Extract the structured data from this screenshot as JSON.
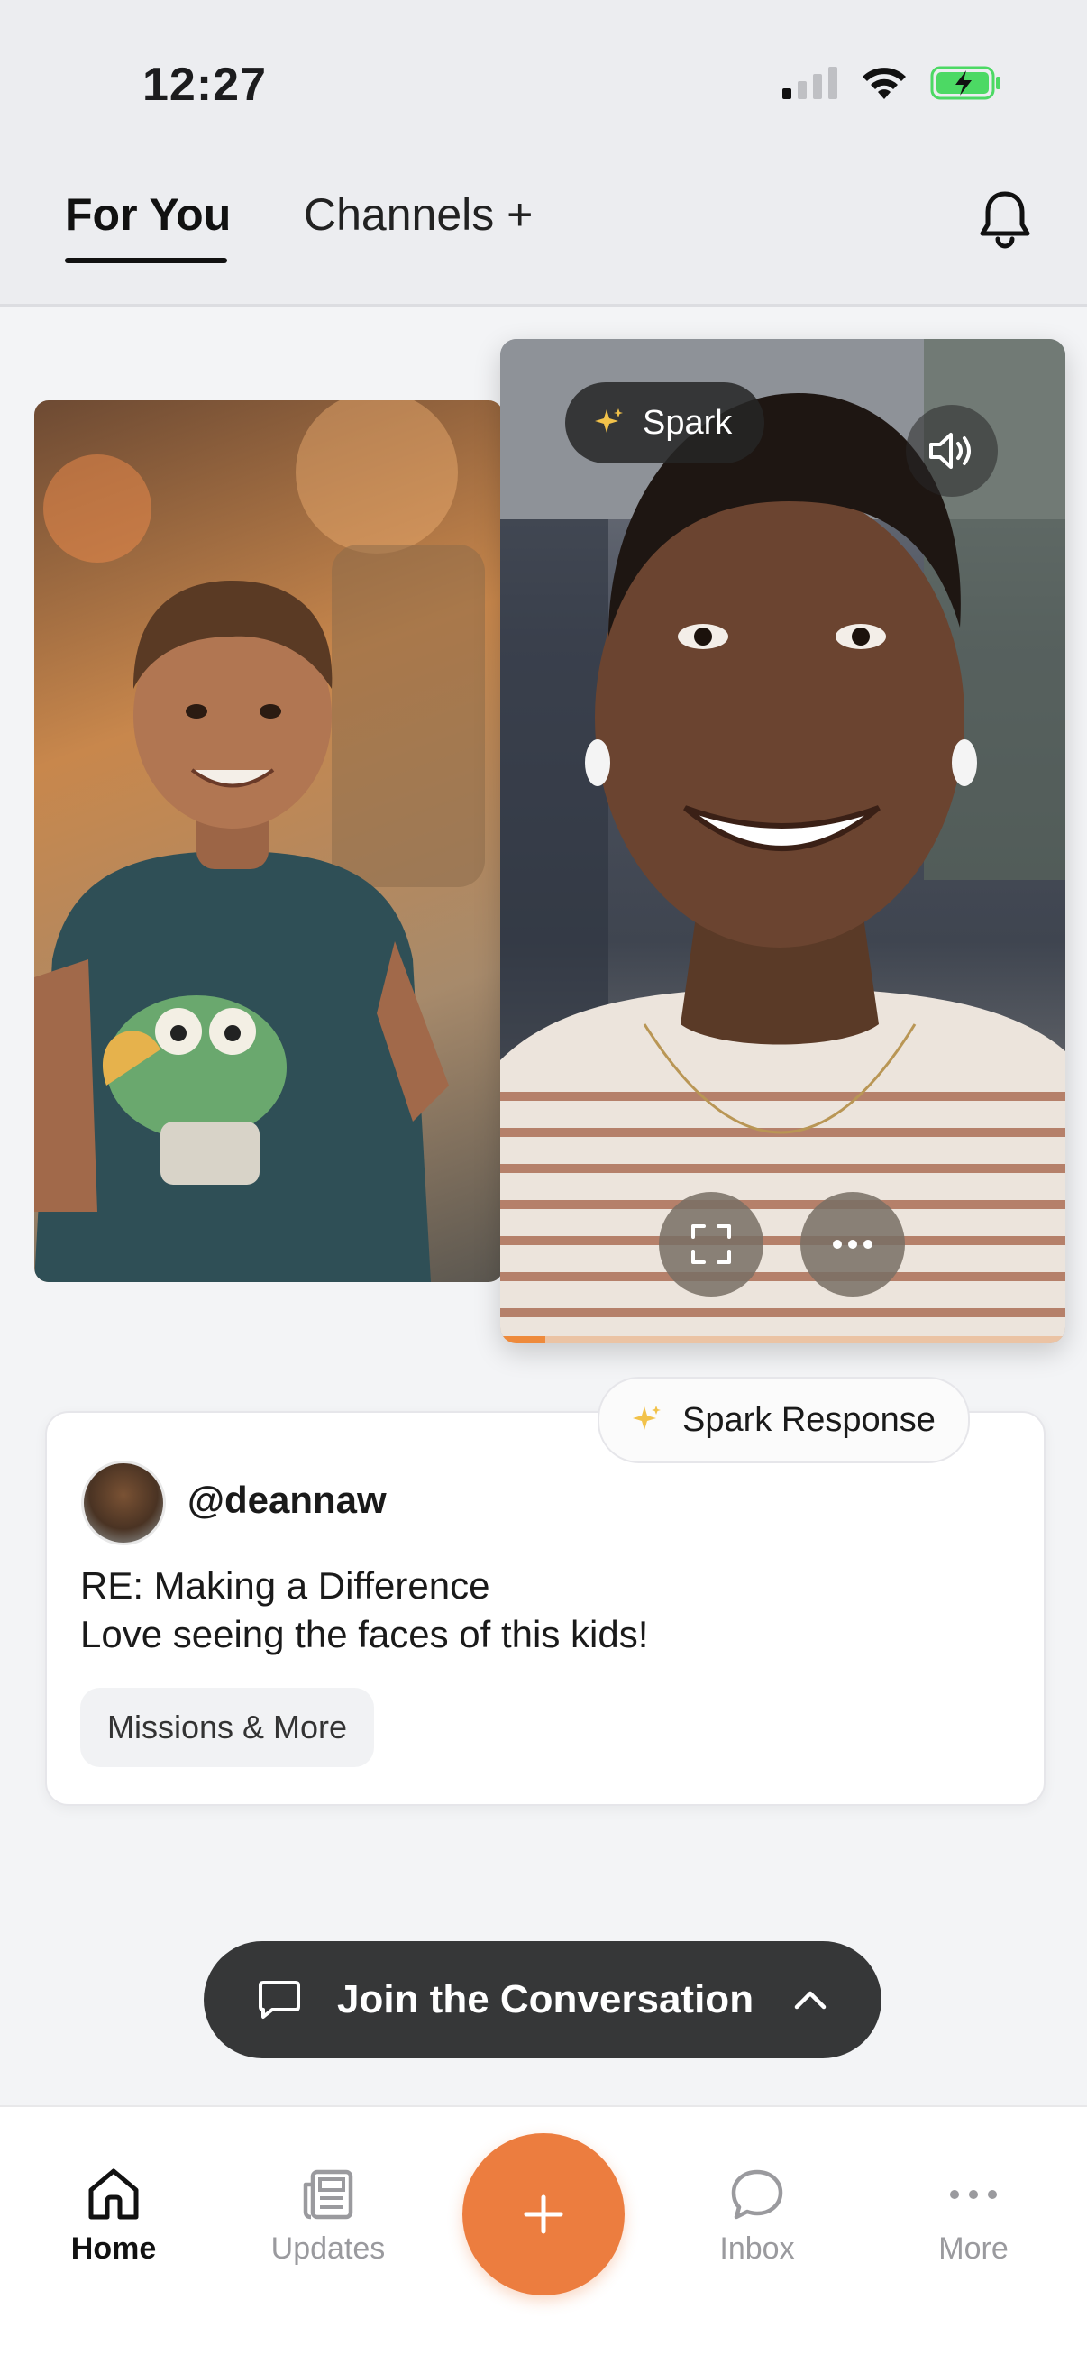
{
  "status_bar": {
    "time": "12:27"
  },
  "header": {
    "tabs": [
      {
        "label": "For You",
        "active": true
      },
      {
        "label": "Channels +",
        "active": false
      }
    ]
  },
  "media": {
    "spark_label": "Spark",
    "progress": 0.08
  },
  "post": {
    "spark_response_label": "Spark Response",
    "username": "@deannaw",
    "line1": "RE: Making a Difference",
    "line2": "Love seeing the faces of this kids!",
    "tag": "Missions & More"
  },
  "join": {
    "label": "Join the Conversation"
  },
  "nav": {
    "items": [
      {
        "label": "Home",
        "icon": "home-icon",
        "active": true
      },
      {
        "label": "Updates",
        "icon": "newspaper-icon",
        "active": false
      },
      {
        "label": "Inbox",
        "icon": "chat-bubble-icon",
        "active": false
      },
      {
        "label": "More",
        "icon": "more-dots-icon",
        "active": false
      }
    ]
  },
  "colors": {
    "accent": "#ec7d3f",
    "dark_bar": "#363738",
    "battery": "#4cd964"
  }
}
